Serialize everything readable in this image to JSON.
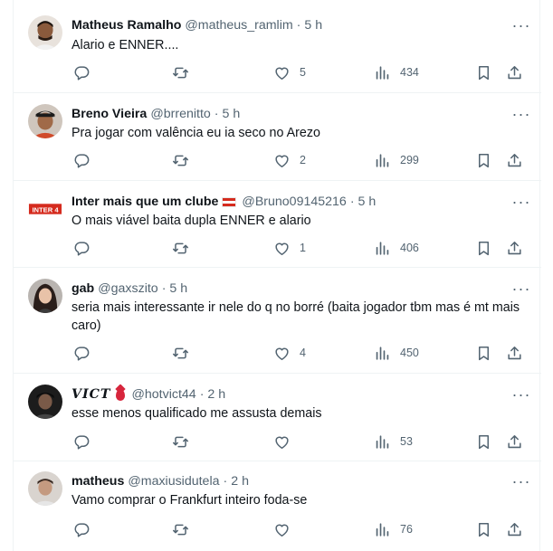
{
  "tweets": [
    {
      "name": "Matheus Ramalho",
      "handle": "@matheus_ramlim",
      "time": "5 h",
      "text": "Alario e ENNER....",
      "likes": "5",
      "views": "434",
      "replies": "",
      "retweets": ""
    },
    {
      "name": "Breno Vieira",
      "handle": "@brrenitto",
      "time": "5 h",
      "text": "Pra jogar com valência eu ia seco no Arezo",
      "likes": "2",
      "views": "299",
      "replies": "",
      "retweets": ""
    },
    {
      "name": "Inter mais que um clube",
      "handle": "@Bruno09145216",
      "time": "5 h",
      "text": "O mais viável baita dupla ENNER e alario",
      "likes": "1",
      "views": "406",
      "replies": "",
      "retweets": "",
      "avatar_text": "INTER 4"
    },
    {
      "name": "gab",
      "handle": "@gaxszito",
      "time": "5 h",
      "text": "seria mais interessante ir nele do q no borré (baita jogador tbm mas é mt mais caro)",
      "likes": "4",
      "views": "450",
      "replies": "",
      "retweets": ""
    },
    {
      "name": "VICT",
      "handle": "@hotvict44",
      "time": "2 h",
      "text": "esse menos qualificado me assusta demais",
      "likes": "",
      "views": "53",
      "replies": "",
      "retweets": ""
    },
    {
      "name": "matheus",
      "handle": "@maxiusidutela",
      "time": "2 h",
      "text": "Vamo comprar o Frankfurt inteiro foda-se",
      "likes": "",
      "views": "76",
      "replies": "",
      "retweets": ""
    }
  ],
  "ui": {
    "separator": "·",
    "more_label": "···"
  },
  "colors": {
    "text": "#0f1419",
    "secondary": "#536471",
    "border": "#eff3f4",
    "inter_red": "#d52b1e"
  },
  "icons": [
    "reply-icon",
    "retweet-icon",
    "like-icon",
    "views-icon",
    "bookmark-icon",
    "share-icon",
    "more-icon"
  ]
}
